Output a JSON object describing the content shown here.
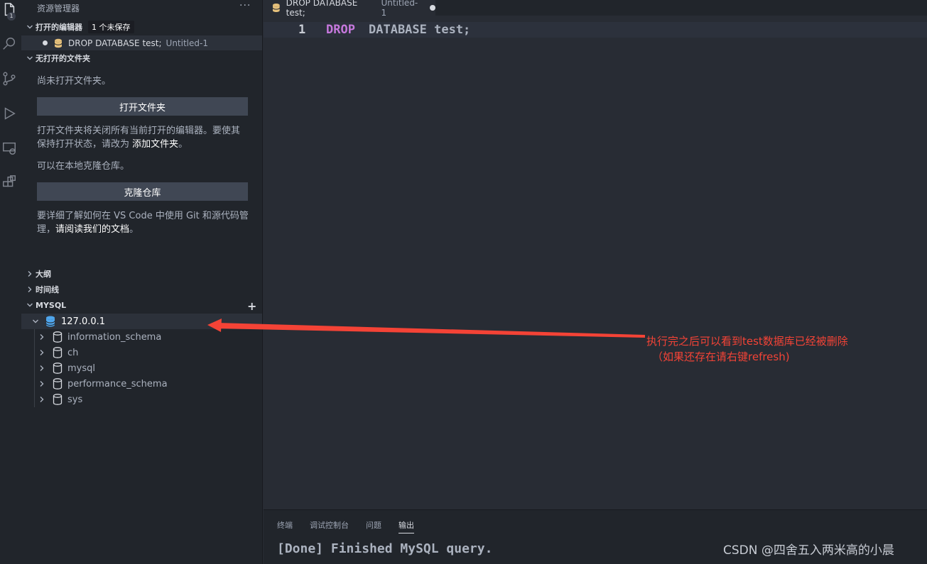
{
  "sidebar": {
    "title": "资源管理器",
    "more": "···",
    "open_editors": {
      "label": "打开的编辑器",
      "badge": "1 个未保存",
      "file_name": "DROP DATABASE test;",
      "file_sub": "Untitled-1"
    },
    "no_folder": {
      "label": "无打开的文件夹",
      "msg1": "尚未打开文件夹。",
      "open_button": "打开文件夹",
      "msg2a": "打开文件夹将关闭所有当前打开的编辑器。要使其",
      "msg2b": "保持打开状态，请改为",
      "add_folder_link": "添加文件夹",
      "msg2c": "。",
      "msg3": "可以在本地克隆仓库。",
      "clone_button": "克隆仓库",
      "msg4a": "要详细了解如何在 VS Code 中使用 Git 和源代码管",
      "msg4b": "理，",
      "docs_link": "请阅读我们的文档",
      "msg4c": "。"
    },
    "outline_label": "大纲",
    "timeline_label": "时间线",
    "mysql": {
      "label": "MYSQL",
      "add": "+",
      "host": "127.0.0.1",
      "databases": [
        "information_schema",
        "ch",
        "mysql",
        "performance_schema",
        "sys"
      ]
    }
  },
  "activity": {
    "badge": "1"
  },
  "editor": {
    "tab_name": "DROP DATABASE test;",
    "tab_sub": "Untitled-1",
    "line_number": "1",
    "keyword": "DROP",
    "rest": "DATABASE test;"
  },
  "panel": {
    "tabs": [
      "终端",
      "调试控制台",
      "问题",
      "输出"
    ],
    "active_tab": "输出",
    "output_line": "[Done] Finished MySQL query."
  },
  "annotation": {
    "line1": "执行完之后可以看到test数据库已经被删除",
    "line2": "（如果还存在请右键refresh)"
  },
  "watermark": "CSDN @四舍五入两米高的小晨",
  "colors": {
    "accent_red": "#f44336",
    "db_yellow": "#e5c07b",
    "db_blue": "#4fa6ed",
    "keyword": "#c678dd"
  },
  "icons": [
    "files-icon",
    "search-icon",
    "source-control-icon",
    "run-debug-icon",
    "remote-explorer-icon",
    "extensions-icon",
    "database-icon",
    "chevron-down-icon",
    "chevron-right-icon",
    "plus-icon"
  ]
}
